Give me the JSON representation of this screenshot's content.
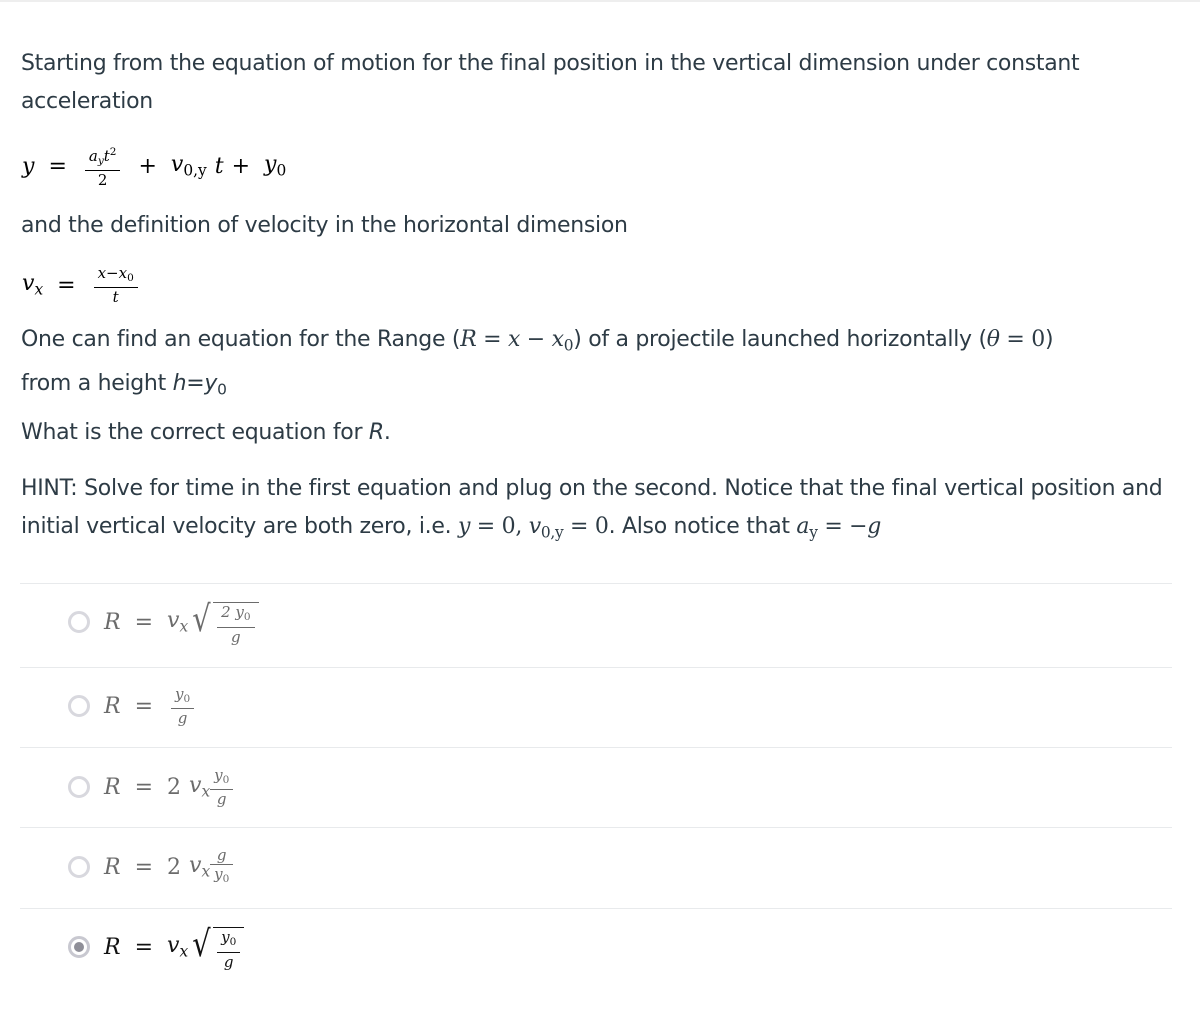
{
  "question": {
    "intro": "Starting from the equation of motion for the final position in the vertical dimension under constant acceleration",
    "eq1": {
      "lhs": "y",
      "eq": "=",
      "frac_num": "a",
      "frac_num_sub": "y",
      "frac_num_t": "t",
      "frac_num_exp": "2",
      "frac_den": "2",
      "plus1": "+",
      "v": "v",
      "v_sub": "0,y",
      "t": "t",
      "plus2": "+",
      "y0": "y",
      "y0_sub": "0"
    },
    "mid": "and the definition of velocity in the horizontal dimension",
    "eq2": {
      "lhs": "v",
      "lhs_sub": "x",
      "eq": "=",
      "num": "x−x",
      "num_sub": "0",
      "den": "t"
    },
    "range_text_1": "One can find an equation for the Range (",
    "range_R": "R",
    "range_eq": " = ",
    "range_x": "x",
    "range_minus": " − ",
    "range_x0": "x",
    "range_x0_sub": "0",
    "range_text_2": ") of a projectile launched horizontally (",
    "range_theta": "θ",
    "range_theta_eq": " = ",
    "range_zero": "0",
    "range_text_3": ")",
    "height_text": "from a height ",
    "height_h": "h",
    "height_eq": "=",
    "height_y": "y",
    "height_sub": "0",
    "ask": "What is the correct equation for ",
    "ask_R": "R",
    "ask_end": ".",
    "hint_1": "HINT: Solve for time in the first equation and plug on the second. Notice that the final vertical position and initial vertical velocity are both zero, i.e. ",
    "hint_y": "y",
    "hint_eq1": " = ",
    "hint_zero1": "0, ",
    "hint_v": "v",
    "hint_v_sub": "0,y",
    "hint_eq2": " = ",
    "hint_zero2": "0",
    "hint_2": ". Also notice that ",
    "hint_a": "a",
    "hint_a_sub": "y",
    "hint_eq3": " = −",
    "hint_g": "g"
  },
  "answers": [
    {
      "label": "R = vx sqrt(2 y0 / g)",
      "R": "R",
      "eq": "=",
      "coef": "",
      "v": "v",
      "v_sub": "x",
      "num": "2 y",
      "num_sub": "0",
      "den": "g",
      "sqrt": true,
      "selected": false
    },
    {
      "label": "R = y0 / g",
      "R": "R",
      "eq": "=",
      "num": "y",
      "num_sub": "0",
      "den": "g",
      "selected": false
    },
    {
      "label": "R = 2 vx y0 / g",
      "R": "R",
      "eq": "=",
      "coef": "2",
      "v": "v",
      "v_sub": "x",
      "num": "y",
      "num_sub": "0",
      "den": "g",
      "selected": false
    },
    {
      "label": "R = 2 vx g / y0",
      "R": "R",
      "eq": "=",
      "coef": "2",
      "v": "v",
      "v_sub": "x",
      "num": "g",
      "den": "y",
      "den_sub": "0",
      "selected": false
    },
    {
      "label": "R = vx sqrt(y0 / g)",
      "R": "R",
      "eq": "=",
      "v": "v",
      "v_sub": "x",
      "num": "y",
      "num_sub": "0",
      "den": "g",
      "sqrt": true,
      "selected": true
    }
  ],
  "sqrt_symbol": "√"
}
